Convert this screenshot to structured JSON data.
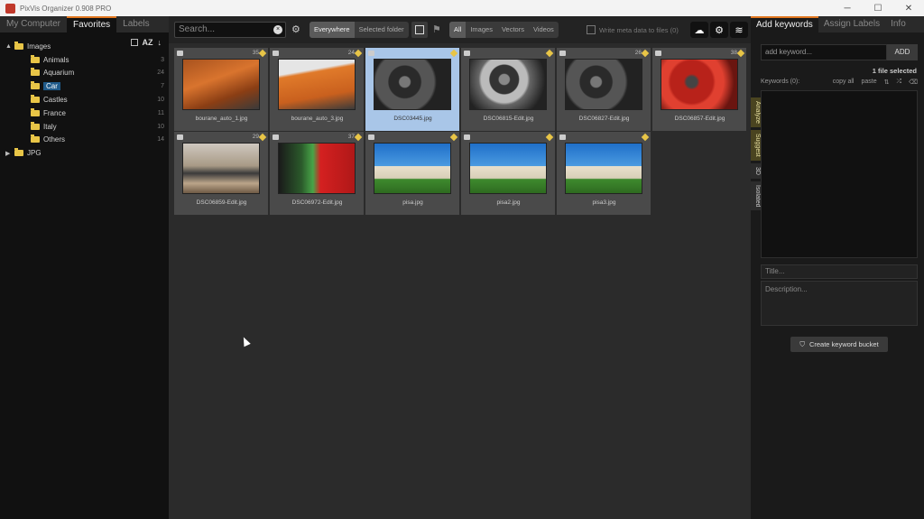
{
  "window": {
    "title": "PixVis Organizer 0.908 PRO",
    "controls": [
      "─",
      "☐",
      "✕"
    ]
  },
  "left_panel": {
    "tabs": [
      "My Computer",
      "Favorites",
      "Labels"
    ],
    "active_tab": "Favorites",
    "sort_label": "AZ",
    "tree": [
      {
        "label": "Images",
        "count": "",
        "level": 0,
        "expanded": true
      },
      {
        "label": "Animals",
        "count": "3",
        "level": 1
      },
      {
        "label": "Aquarium",
        "count": "24",
        "level": 1
      },
      {
        "label": "Car",
        "count": "7",
        "level": 1,
        "selected": true
      },
      {
        "label": "Castles",
        "count": "10",
        "level": 1
      },
      {
        "label": "France",
        "count": "11",
        "level": 1
      },
      {
        "label": "Italy",
        "count": "10",
        "level": 1
      },
      {
        "label": "Others",
        "count": "14",
        "level": 1
      },
      {
        "label": "JPG",
        "count": "",
        "level": 0,
        "expanded": false
      }
    ]
  },
  "toolbar": {
    "search_placeholder": "Search...",
    "scope": [
      "Everywhere",
      "Selected folder"
    ],
    "scope_active": "Everywhere",
    "filter": [
      "All",
      "Images",
      "Vectors",
      "Videos"
    ],
    "filter_active": "All",
    "write_meta": "Write meta data to files (0)"
  },
  "grid": [
    {
      "name": "bourane_auto_1.jpg",
      "num": "35",
      "thumb": "orange"
    },
    {
      "name": "bourane_auto_3.jpg",
      "num": "24",
      "thumb": "orange2"
    },
    {
      "name": "DSC03445.jpg",
      "num": "",
      "thumb": "int",
      "selected": true
    },
    {
      "name": "DSC06815-Edit.jpg",
      "num": "",
      "thumb": "int2"
    },
    {
      "name": "DSC06827-Edit.jpg",
      "num": "26",
      "thumb": "int"
    },
    {
      "name": "DSC06857-Edit.jpg",
      "num": "38",
      "thumb": "red"
    },
    {
      "name": "DSC06859-Edit.jpg",
      "num": "29",
      "thumb": "tan"
    },
    {
      "name": "DSC06972-Edit.jpg",
      "num": "37",
      "thumb": "fuel"
    },
    {
      "name": "pisa.jpg",
      "num": "",
      "thumb": "pisa"
    },
    {
      "name": "pisa2.jpg",
      "num": "",
      "thumb": "pisa"
    },
    {
      "name": "pisa3.jpg",
      "num": "",
      "thumb": "pisa"
    }
  ],
  "right_panel": {
    "tabs": [
      "Add keywords",
      "Assign Labels",
      "Info"
    ],
    "active_tab": "Add keywords",
    "keyword_placeholder": "add keyword...",
    "add_label": "ADD",
    "files_selected": "1 file selected",
    "keywords_label": "Keywords (0):",
    "copy_all": "copy all",
    "paste": "paste",
    "side_tabs": [
      "Analyze",
      "Suggest",
      "3D",
      "Isolated"
    ],
    "title_placeholder": "Title...",
    "description_placeholder": "Description...",
    "bucket_label": "Create keyword bucket"
  }
}
